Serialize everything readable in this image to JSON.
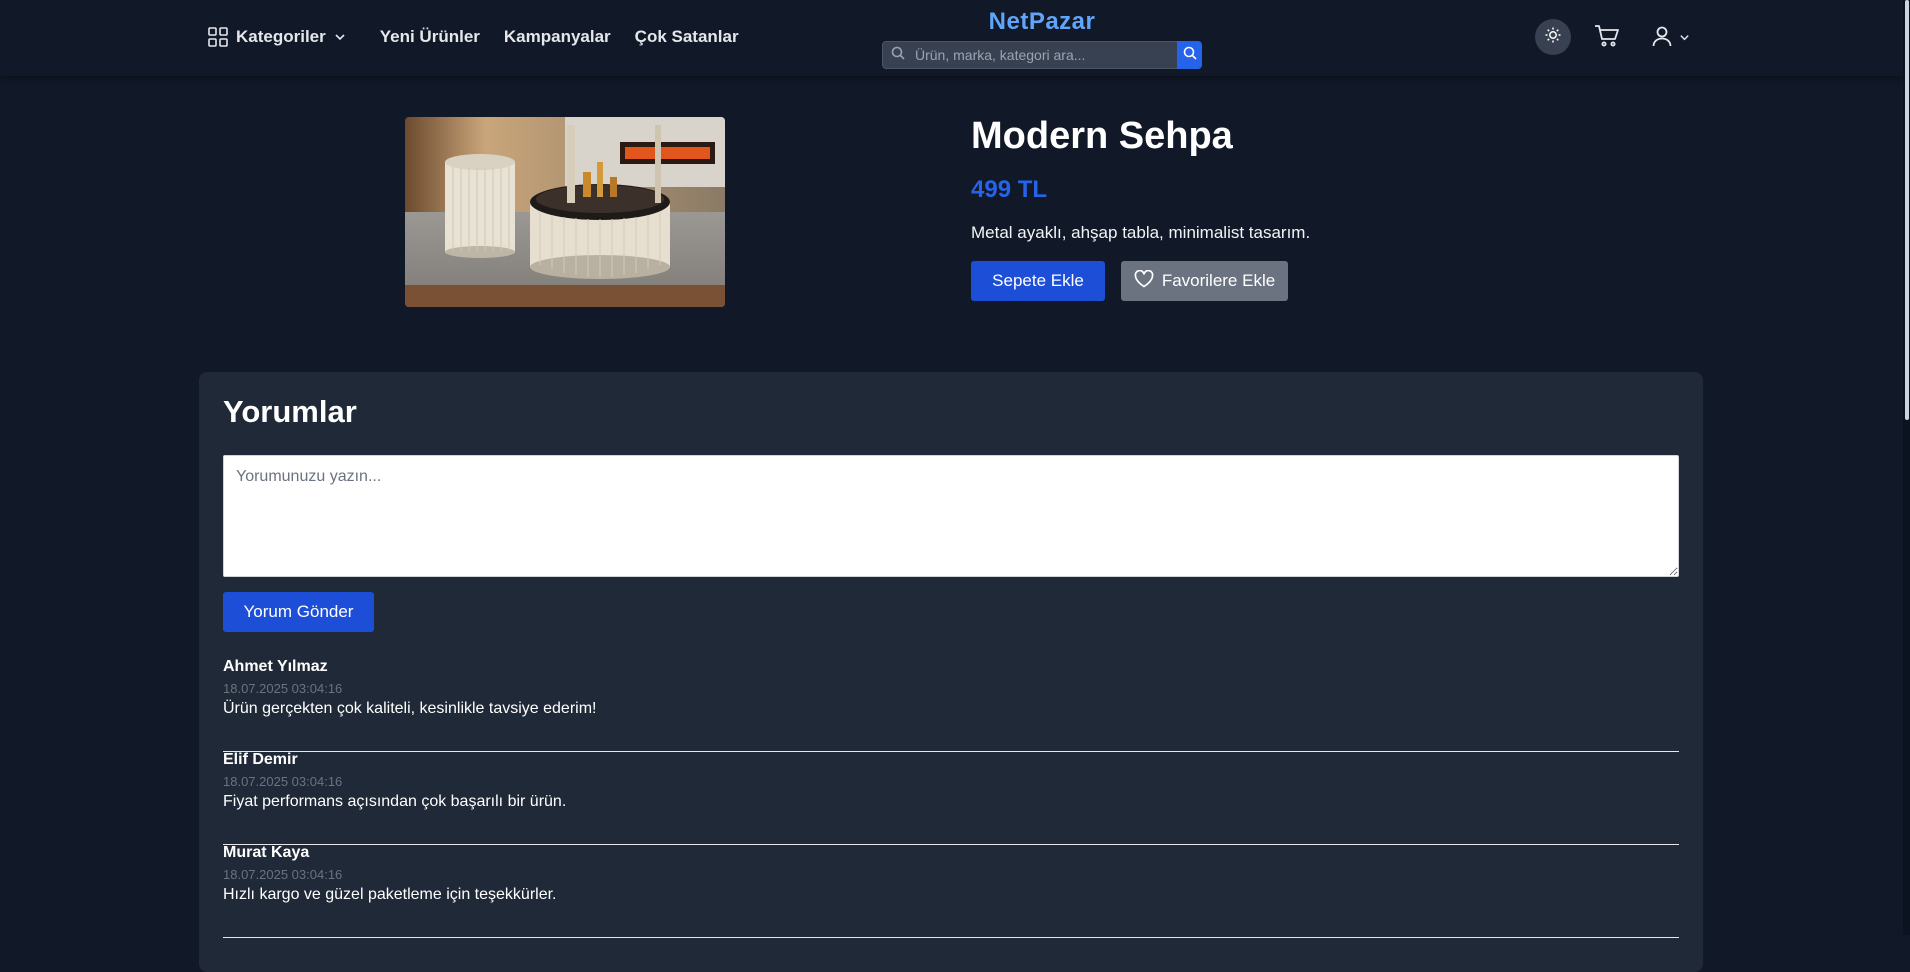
{
  "header": {
    "brand": "NetPazar",
    "categories_label": "Kategoriler",
    "nav_links": [
      "Yeni Ürünler",
      "Kampanyalar",
      "Çok Satanlar"
    ],
    "search": {
      "placeholder": "Ürün, marka, kategori ara...",
      "value": ""
    }
  },
  "product": {
    "title": "Modern Sehpa",
    "price": "499 TL",
    "description": "Metal ayaklı, ahşap tabla, minimalist tasarım.",
    "add_to_cart_label": "Sepete Ekle",
    "favorite_label": "Favorilere Ekle"
  },
  "comments": {
    "title": "Yorumlar",
    "input_placeholder": "Yorumunuzu yazın...",
    "submit_label": "Yorum Gönder",
    "items": [
      {
        "author": "Ahmet Yılmaz",
        "date": "18.07.2025 03:04:16",
        "text": "Ürün gerçekten çok kaliteli, kesinlikle tavsiye ederim!"
      },
      {
        "author": "Elif Demir",
        "date": "18.07.2025 03:04:16",
        "text": "Fiyat performans açısından çok başarılı bir ürün."
      },
      {
        "author": "Murat Kaya",
        "date": "18.07.2025 03:04:16",
        "text": "Hızlı kargo ve güzel paketleme için teşekkürler."
      }
    ]
  },
  "colors": {
    "background": "#111827",
    "card": "#1f2937",
    "accent": "#2563eb",
    "brand": "#60a5fa",
    "secondary_button": "#6b7280"
  },
  "icons": [
    "grid-icon",
    "chevron-down-icon",
    "search-icon",
    "sun-icon",
    "cart-icon",
    "user-icon",
    "heart-icon"
  ]
}
